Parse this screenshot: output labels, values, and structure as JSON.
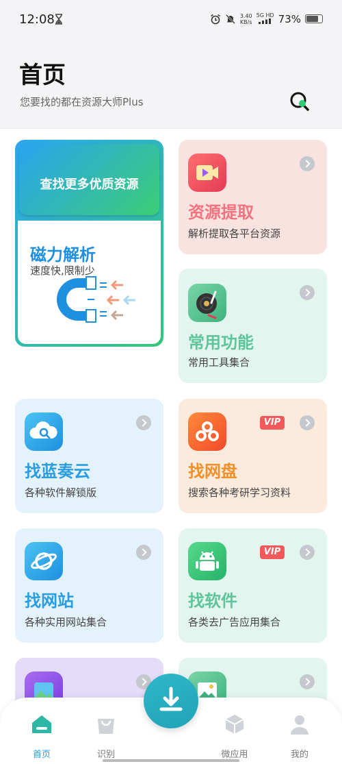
{
  "status": {
    "time": "12:08",
    "net_speed_value": "3.40",
    "net_speed_unit": "KB/s",
    "network": "5G HD",
    "battery": "73%"
  },
  "header": {
    "title": "首页",
    "subtitle": "您要找的都在资源大师Plus"
  },
  "featured": {
    "banner": "查找更多优质资源",
    "title": "磁力解析",
    "desc": "速度快,限制少"
  },
  "cards": [
    {
      "title": "资源提取",
      "desc": "解析提取各平台资源",
      "color": "#f5727f"
    },
    {
      "title": "常用功能",
      "desc": "常用工具集合",
      "color": "#5fc49a"
    },
    {
      "title": "找蓝奏云",
      "desc": "各种软件解锁版",
      "color": "#2a9de2"
    },
    {
      "title": "找网盘",
      "desc": "搜索各种考研学习资料",
      "color": "#f0902a",
      "badge": "VIP"
    },
    {
      "title": "找网站",
      "desc": "各种实用网站集合",
      "color": "#2a9de2"
    },
    {
      "title": "找软件",
      "desc": "各类去广告应用集合",
      "color": "#5fc49a",
      "badge": "VIP"
    }
  ],
  "nav": {
    "items": [
      {
        "label": "首页",
        "active": true
      },
      {
        "label": "识别",
        "active": false
      },
      {
        "label": "微应用",
        "active": false
      },
      {
        "label": "我的",
        "active": false
      }
    ]
  },
  "colors": {
    "accent": "#2a9de2",
    "green": "#34c77b",
    "vip": "#f05a5a"
  }
}
